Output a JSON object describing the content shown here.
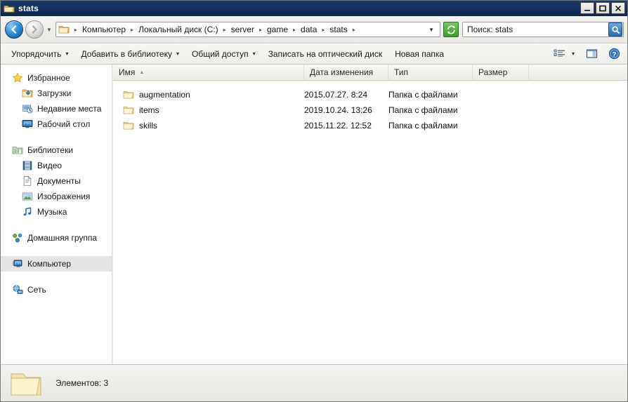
{
  "window": {
    "title": "stats",
    "title_icon": "folder-icon",
    "buttons": {
      "minimize": "_",
      "maximize": "☐",
      "close": "×"
    }
  },
  "navigation": {
    "back_label": "←",
    "back_icon": "back-arrow-icon",
    "forward_label": "→",
    "forward_icon": "forward-arrow-icon",
    "history_icon": "chevron-down-icon",
    "breadcrumb_icon": "folder-icon",
    "breadcrumbs": [
      "Компьютер",
      "Локальный диск (C:)",
      "server",
      "game",
      "data",
      "stats"
    ],
    "separator": "▸",
    "dropdown_icon": "chevron-down-icon",
    "refresh_icon": "refresh-icon",
    "search": {
      "value": "Поиск: stats",
      "placeholder": "Поиск: stats",
      "button_icon": "search-icon"
    }
  },
  "toolbar": {
    "items": [
      {
        "label": "Упорядочить",
        "caret": "▾"
      },
      {
        "label": "Добавить в библиотеку",
        "caret": "▾"
      },
      {
        "label": "Общий доступ",
        "caret": "▾"
      },
      {
        "label": "Записать на оптический диск",
        "caret": ""
      },
      {
        "label": "Новая папка",
        "caret": ""
      }
    ],
    "view_icon": "view-options-icon",
    "view_caret": "▾",
    "preview_icon": "preview-pane-icon",
    "help_icon": "help-icon"
  },
  "sidebar": {
    "groups": [
      {
        "header": {
          "label": "Избранное",
          "icon": "star-icon"
        },
        "items": [
          {
            "label": "Загрузки",
            "icon": "downloads-icon"
          },
          {
            "label": "Недавние места",
            "icon": "recent-places-icon"
          },
          {
            "label": "Рабочий стол",
            "icon": "desktop-icon"
          }
        ]
      },
      {
        "header": {
          "label": "Библиотеки",
          "icon": "library-icon"
        },
        "items": [
          {
            "label": "Видео",
            "icon": "video-icon"
          },
          {
            "label": "Документы",
            "icon": "documents-icon"
          },
          {
            "label": "Изображения",
            "icon": "pictures-icon"
          },
          {
            "label": "Музыка",
            "icon": "music-icon"
          }
        ]
      },
      {
        "header": {
          "label": "Домашняя группа",
          "icon": "homegroup-icon"
        },
        "items": []
      },
      {
        "header": {
          "label": "Компьютер",
          "icon": "computer-icon",
          "selected": true
        },
        "items": []
      },
      {
        "header": {
          "label": "Сеть",
          "icon": "network-icon"
        },
        "items": []
      }
    ]
  },
  "filelist": {
    "columns": [
      {
        "key": "name",
        "label": "Имя",
        "sorted": true,
        "sort_arrow": "▲"
      },
      {
        "key": "date",
        "label": "Дата изменения"
      },
      {
        "key": "type",
        "label": "Тип"
      },
      {
        "key": "size",
        "label": "Размер"
      }
    ],
    "rows": [
      {
        "name": "augmentation",
        "date": "2015.07.27.  8:24",
        "type": "Папка с файлами",
        "size": "",
        "icon": "folder-icon"
      },
      {
        "name": "items",
        "date": "2019.10.24.  13:26",
        "type": "Папка с файлами",
        "size": "",
        "icon": "folder-icon"
      },
      {
        "name": "skills",
        "date": "2015.11.22.  12:52",
        "type": "Папка с файлами",
        "size": "",
        "icon": "folder-icon"
      }
    ]
  },
  "statusbar": {
    "icon": "large-folder-icon",
    "text": "Элементов: 3"
  },
  "colors": {
    "titlebar": "#14315d",
    "chrome": "#eeeee8",
    "selection": "#e4e4e4",
    "folder_yellow": "#ffd98a",
    "accent_blue": "#2b6cb5",
    "refresh_green": "#3f9a2e"
  }
}
